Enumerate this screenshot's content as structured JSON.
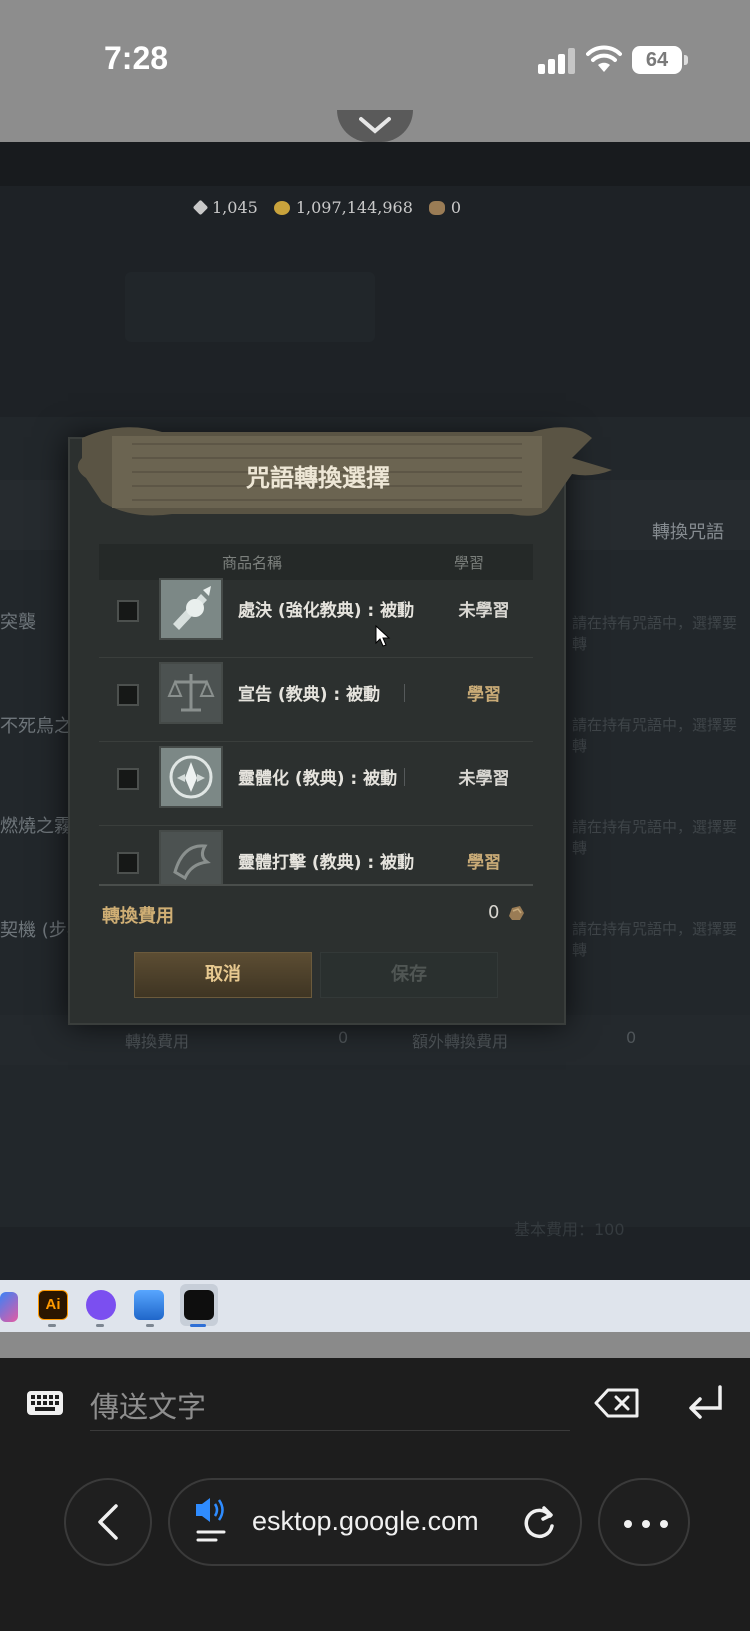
{
  "status_bar": {
    "time": "7:28",
    "battery": "64"
  },
  "game": {
    "currency": {
      "diamond": "1,045",
      "gold": "1,097,144,968",
      "ore": "0"
    },
    "background": {
      "convert_spell_label": "轉換咒語",
      "left_labels": [
        "突襲",
        "不死鳥之",
        "燃燒之霧",
        "契機 (步兵"
      ],
      "right_texts": [
        "請在持有咒語中，選擇要轉",
        "請在持有咒語中，選擇要轉",
        "請在持有咒語中，選擇要轉",
        "請在持有咒語中，選擇要轉"
      ],
      "footer_cost_label": "轉換費用",
      "footer_cost_value": "0",
      "footer_extra_label": "額外轉換費用",
      "footer_extra_value": "0",
      "bottom_text": "基本費用：100"
    }
  },
  "modal": {
    "title": "咒語轉換選擇",
    "header": {
      "name": "商品名稱",
      "learn": "學習"
    },
    "items": [
      {
        "name": "處決 (強化教典) : 被動",
        "status": "未學習",
        "learned": false
      },
      {
        "name": "宣告 (教典) : 被動",
        "status": "學習",
        "learned": true
      },
      {
        "name": "靈體化 (教典) : 被動",
        "status": "未學習",
        "learned": false
      },
      {
        "name": "靈體打擊 (教典) : 被動",
        "status": "學習",
        "learned": true
      }
    ],
    "cost_label": "轉換費用",
    "cost_value": "0",
    "cancel_label": "取消",
    "save_label": "保存"
  },
  "taskbar": {
    "icons": [
      "copilot-icon",
      "illustrator-icon",
      "assistant-icon",
      "photos-icon",
      "game-icon"
    ],
    "ai_label": "Ai"
  },
  "keyboard_bar": {
    "input_placeholder": "傳送文字"
  },
  "browser": {
    "url": "esktop.google.com"
  },
  "colors": {
    "learned": "#c9ab77",
    "unlearned": "#d9d7d2",
    "accent_gold": "#cfae74"
  }
}
